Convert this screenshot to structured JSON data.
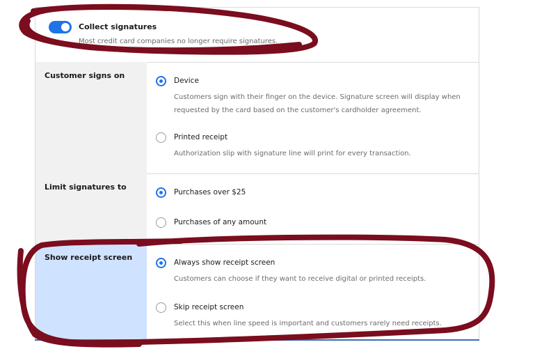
{
  "collect": {
    "title": "Collect signatures",
    "description": "Most credit card companies no longer require signatures.",
    "enabled": true
  },
  "customer_signs_on": {
    "label": "Customer signs on",
    "options": [
      {
        "label": "Device",
        "description": "Customers sign with their finger on the device. Signature screen will display when requested by the card based on the customer's cardholder agreement.",
        "selected": true
      },
      {
        "label": "Printed receipt",
        "description": "Authorization slip with signature line will print for every transaction.",
        "selected": false
      }
    ]
  },
  "limit_signatures": {
    "label": "Limit signatures to",
    "options": [
      {
        "label": "Purchases over $25",
        "selected": true
      },
      {
        "label": "Purchases of any amount",
        "selected": false
      }
    ]
  },
  "receipt_screen": {
    "label": "Show receipt screen",
    "options": [
      {
        "label": "Always show receipt screen",
        "description": "Customers can choose if they want to receive digital or printed receipts.",
        "selected": true
      },
      {
        "label": "Skip receipt screen",
        "description": "Select this when line speed is important and customers rarely need receipts.",
        "selected": false
      }
    ]
  },
  "colors": {
    "accent": "#1f73e8",
    "highlight": "#cfe2ff",
    "annotation": "#7a0d1e"
  }
}
